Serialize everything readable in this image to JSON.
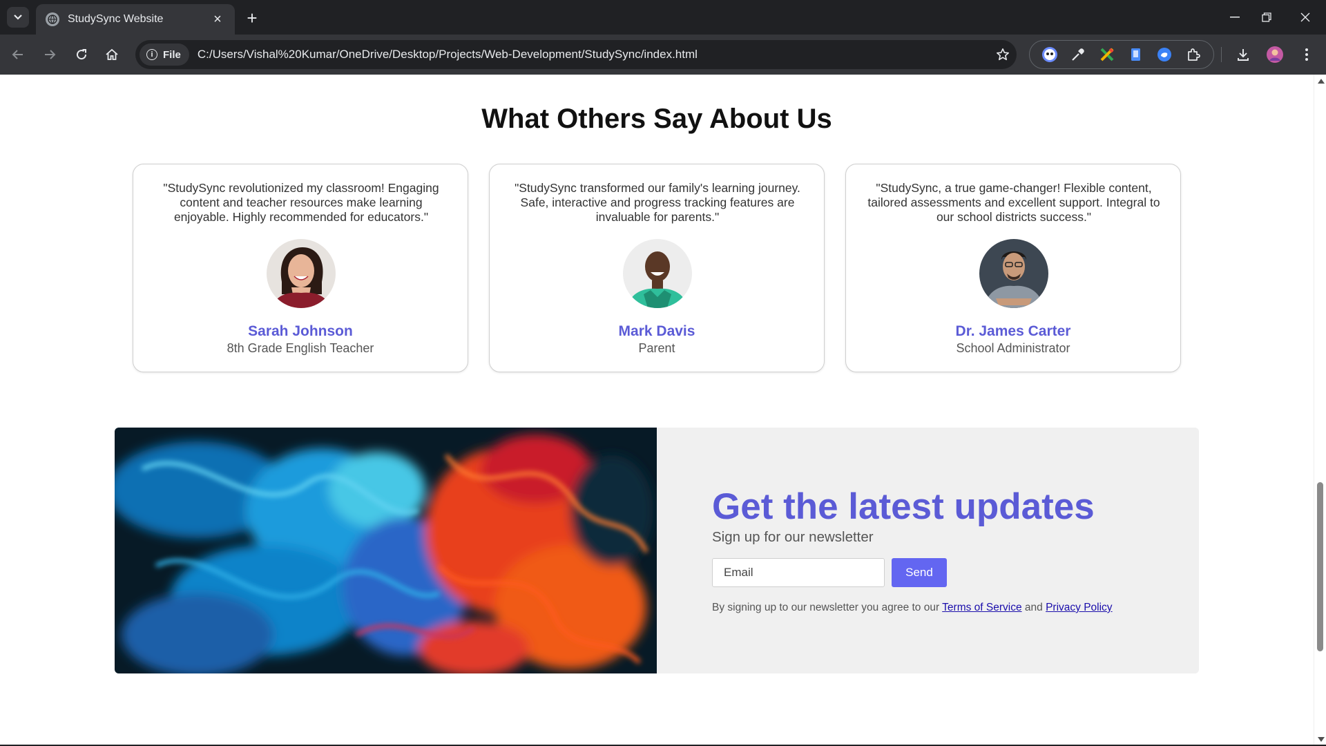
{
  "browser": {
    "tab_title": "StudySync Website",
    "site_chip": "File",
    "url": "C:/Users/Vishal%20Kumar/OneDrive/Desktop/Projects/Web-Development/StudySync/index.html"
  },
  "testimonials": {
    "heading": "What Others Say About Us",
    "items": [
      {
        "quote": "\"StudySync revolutionized my classroom! Engaging content and teacher resources make learning enjoyable. Highly recommended for educators.\"",
        "name": "Sarah Johnson",
        "role": "8th Grade English Teacher"
      },
      {
        "quote": "\"StudySync transformed our family's learning journey. Safe, interactive and progress tracking features are invaluable for parents.\"",
        "name": "Mark Davis",
        "role": "Parent"
      },
      {
        "quote": "\"StudySync, a true game-changer! Flexible content, tailored assessments and excellent support. Integral to our school districts success.\"",
        "name": "Dr. James Carter",
        "role": "School Administrator"
      }
    ]
  },
  "newsletter": {
    "title": "Get the latest updates",
    "subtitle": "Sign up for our newsletter",
    "email_placeholder": "Email",
    "send_label": "Send",
    "legal_prefix": "By signing up to our newsletter you agree to our",
    "terms_label": "Terms of Service",
    "legal_and": "and",
    "privacy_label": "Privacy Policy"
  },
  "colors": {
    "accent": "#5b5bd6",
    "button": "#6366f1",
    "link": "#1a0dab"
  }
}
